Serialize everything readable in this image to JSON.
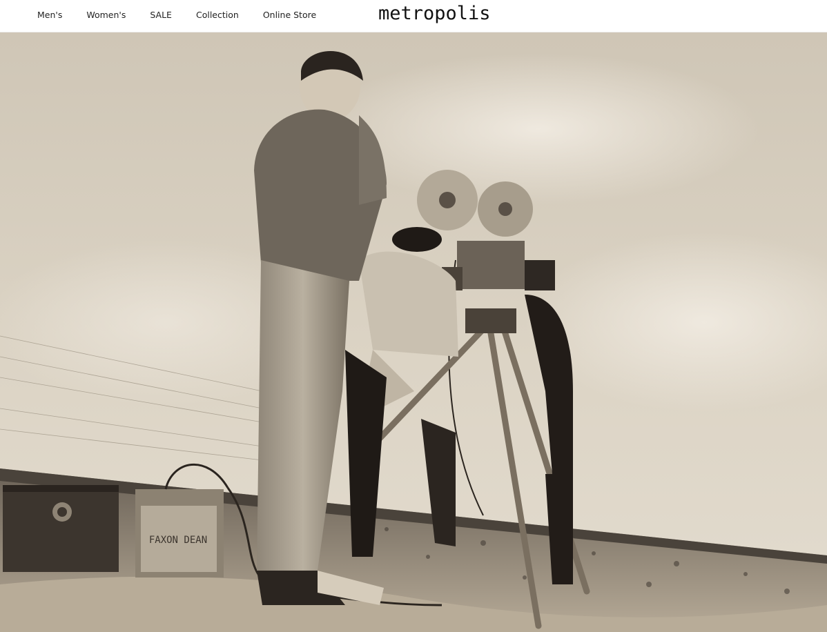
{
  "header": {
    "nav": [
      {
        "label": "Men's"
      },
      {
        "label": "Women's"
      },
      {
        "label": "SALE"
      },
      {
        "label": "Collection"
      },
      {
        "label": "Online Store"
      }
    ],
    "brand": "metropolis"
  },
  "hero": {
    "image": "vintage-film-crew-photo",
    "case_text": "FAXON DEAN"
  },
  "colors": {
    "sky": "#d8cfbe",
    "ground": "#b9ad99",
    "sepia_dark": "#3b342c",
    "sepia_mid": "#8d8070"
  }
}
